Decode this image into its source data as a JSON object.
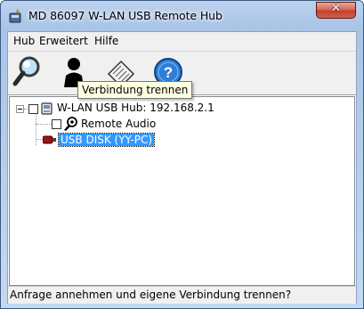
{
  "window": {
    "title": "MD 86097 W-LAN USB Remote Hub",
    "close_glyph": "✕"
  },
  "menu": {
    "items": [
      "Hub",
      "Erweitert",
      "Hilfe"
    ]
  },
  "toolbar": {
    "buttons": [
      {
        "icon": "magnifier-icon"
      },
      {
        "icon": "connect-user-icon"
      },
      {
        "icon": "disconnect-icon"
      },
      {
        "icon": "help-icon"
      }
    ],
    "tooltip": "Verbindung trennen"
  },
  "tree": {
    "hub_label": "W-LAN USB Hub: 192.168.2.1",
    "devices": [
      {
        "label": "Remote Audio",
        "icon": "audio-device-icon"
      },
      {
        "label": "USB DISK (YY-PC)",
        "icon": "usb-disk-icon",
        "selected": true
      }
    ]
  },
  "status": {
    "text": "Anfrage annehmen und eigene Verbindung trennen?"
  },
  "colors": {
    "selection": "#3399ff",
    "tooltip_bg": "#ffffe1",
    "close_button": "#c3402e"
  }
}
